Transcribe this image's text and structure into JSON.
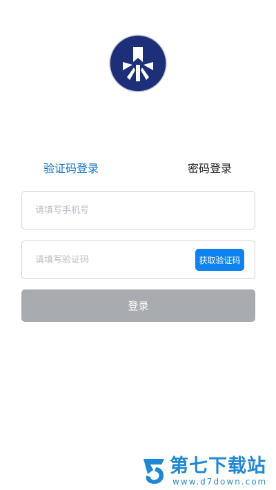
{
  "colors": {
    "logo_bg": "#1e2f7a",
    "tab_active": "#1976c8",
    "tab_inactive": "#222222",
    "primary_button": "#0d83f1",
    "login_button_disabled": "#a8abaf",
    "watermark": "#1f88d6"
  },
  "logo": {
    "icon": "app-logo-icon"
  },
  "tabs": [
    {
      "label": "验证码登录",
      "active": true
    },
    {
      "label": "密码登录",
      "active": false
    }
  ],
  "form": {
    "phone_placeholder": "请填写手机号",
    "code_placeholder": "请填写验证码",
    "get_code_label": "获取验证码",
    "login_label": "登录"
  },
  "watermark": {
    "title": "第七下载站",
    "url": "www.d7down.com"
  }
}
